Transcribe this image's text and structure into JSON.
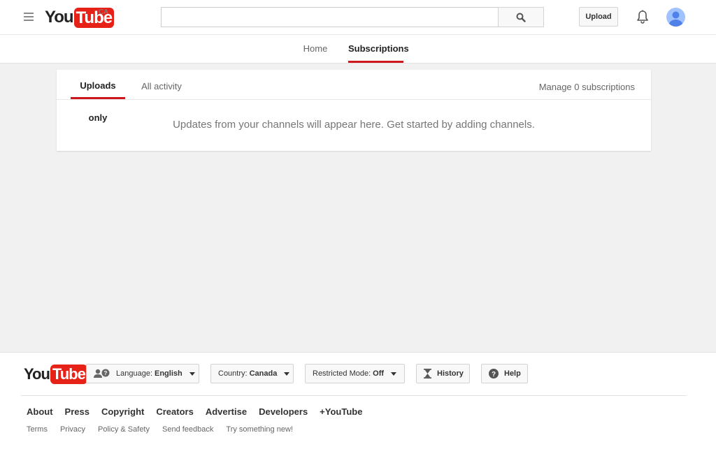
{
  "masthead": {
    "logo_you": "You",
    "logo_tube": "Tube",
    "region": "CA",
    "search": {
      "value": "",
      "placeholder": ""
    },
    "upload_label": "Upload"
  },
  "nav": {
    "tabs": [
      {
        "label": "Home",
        "active": false
      },
      {
        "label": "Subscriptions",
        "active": true
      }
    ]
  },
  "feed": {
    "tabs": [
      {
        "label": "Uploads only",
        "active": true
      },
      {
        "label": "All activity",
        "active": false
      }
    ],
    "manage_label": "Manage 0 subscriptions",
    "empty_message": "Updates from your channels will appear here. Get started by adding channels."
  },
  "footer": {
    "logo_you": "You",
    "logo_tube": "Tube",
    "buttons": {
      "language": {
        "label": "Language:",
        "value": "English"
      },
      "country": {
        "label": "Country:",
        "value": "Canada"
      },
      "restricted": {
        "label": "Restricted Mode:",
        "value": "Off"
      },
      "history": {
        "label": "History"
      },
      "help": {
        "label": "Help"
      }
    },
    "primary_links": [
      "About",
      "Press",
      "Copyright",
      "Creators",
      "Advertise",
      "Developers",
      "+YouTube"
    ],
    "secondary_links": [
      "Terms",
      "Privacy",
      "Policy & Safety",
      "Send feedback",
      "Try something new!"
    ]
  },
  "colors": {
    "brand_red": "#e62117",
    "tab_underline": "#cc181e",
    "page_background": "#f1f1f1"
  },
  "icons": {
    "menu": "hamburger-menu-icon",
    "search": "search-icon",
    "notifications": "bell-icon",
    "avatar": "default-avatar-icon",
    "language": "language-people-icon",
    "history": "hourglass-icon",
    "help": "question-mark-icon"
  }
}
